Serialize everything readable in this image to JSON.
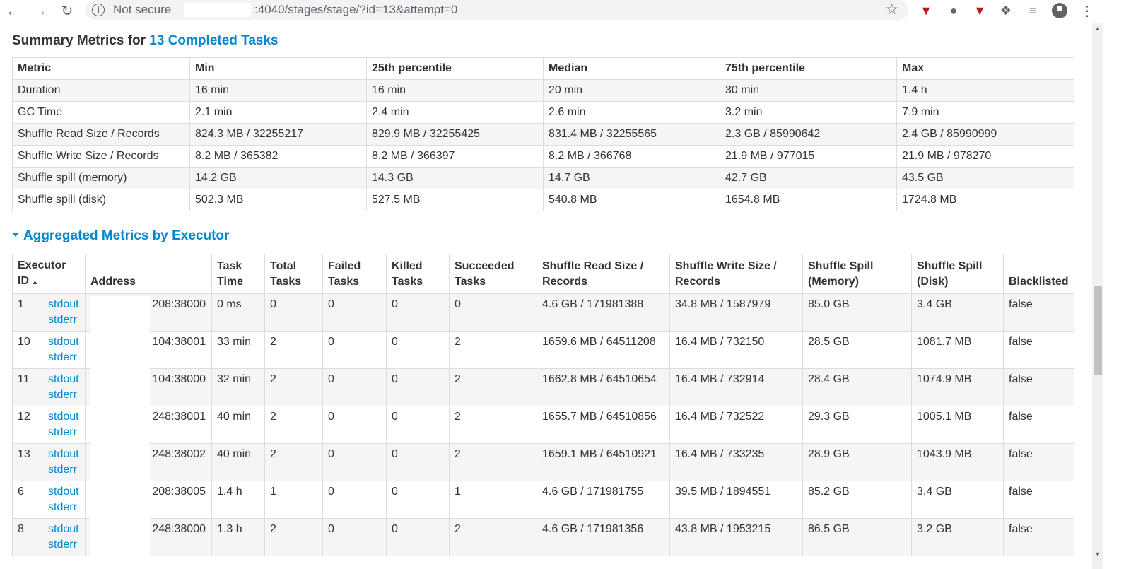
{
  "browser": {
    "secure_label": "Not secure",
    "url": ":4040/stages/stage/?id=13&attempt=0"
  },
  "summary": {
    "title_prefix": "Summary Metrics for ",
    "title_link": "13 Completed Tasks",
    "headers": [
      "Metric",
      "Min",
      "25th percentile",
      "Median",
      "75th percentile",
      "Max"
    ],
    "rows": [
      [
        "Duration",
        "16 min",
        "16 min",
        "20 min",
        "30 min",
        "1.4 h"
      ],
      [
        "GC Time",
        "2.1 min",
        "2.4 min",
        "2.6 min",
        "3.2 min",
        "7.9 min"
      ],
      [
        "Shuffle Read Size / Records",
        "824.3 MB / 32255217",
        "829.9 MB / 32255425",
        "831.4 MB / 32255565",
        "2.3 GB / 85990642",
        "2.4 GB / 85990999"
      ],
      [
        "Shuffle Write Size / Records",
        "8.2 MB / 365382",
        "8.2 MB / 366397",
        "8.2 MB / 366768",
        "21.9 MB / 977015",
        "21.9 MB / 978270"
      ],
      [
        "Shuffle spill (memory)",
        "14.2 GB",
        "14.3 GB",
        "14.7 GB",
        "42.7 GB",
        "43.5 GB"
      ],
      [
        "Shuffle spill (disk)",
        "502.3 MB",
        "527.5 MB",
        "540.8 MB",
        "1654.8 MB",
        "1724.8 MB"
      ]
    ]
  },
  "executors": {
    "title": "Aggregated Metrics by Executor",
    "headers": {
      "executor_id": "Executor ID",
      "address": "Address",
      "task_time": "Task Time",
      "total_tasks": "Total Tasks",
      "failed_tasks": "Failed Tasks",
      "killed_tasks": "Killed Tasks",
      "succeeded_tasks": "Succeeded Tasks",
      "shuffle_read": "Shuffle Read Size / Records",
      "shuffle_write": "Shuffle Write Size / Records",
      "spill_memory": "Shuffle Spill (Memory)",
      "spill_disk": "Shuffle Spill (Disk)",
      "blacklisted": "Blacklisted"
    },
    "sort_indicator": "▲",
    "stdout_label": "stdout",
    "stderr_label": "stderr",
    "rows": [
      {
        "id": "1",
        "address": "208:38000",
        "task_time": "0 ms",
        "total": "0",
        "failed": "0",
        "killed": "0",
        "succeeded": "0",
        "read": "4.6 GB / 171981388",
        "write": "34.8 MB / 1587979",
        "spill_mem": "85.0 GB",
        "spill_disk": "3.4 GB",
        "blacklisted": "false"
      },
      {
        "id": "10",
        "address": "104:38001",
        "task_time": "33 min",
        "total": "2",
        "failed": "0",
        "killed": "0",
        "succeeded": "2",
        "read": "1659.6 MB / 64511208",
        "write": "16.4 MB / 732150",
        "spill_mem": "28.5 GB",
        "spill_disk": "1081.7 MB",
        "blacklisted": "false"
      },
      {
        "id": "11",
        "address": "104:38000",
        "task_time": "32 min",
        "total": "2",
        "failed": "0",
        "killed": "0",
        "succeeded": "2",
        "read": "1662.8 MB / 64510654",
        "write": "16.4 MB / 732914",
        "spill_mem": "28.4 GB",
        "spill_disk": "1074.9 MB",
        "blacklisted": "false"
      },
      {
        "id": "12",
        "address": "248:38001",
        "task_time": "40 min",
        "total": "2",
        "failed": "0",
        "killed": "0",
        "succeeded": "2",
        "read": "1655.7 MB / 64510856",
        "write": "16.4 MB / 732522",
        "spill_mem": "29.3 GB",
        "spill_disk": "1005.1 MB",
        "blacklisted": "false"
      },
      {
        "id": "13",
        "address": "248:38002",
        "task_time": "40 min",
        "total": "2",
        "failed": "0",
        "killed": "0",
        "succeeded": "2",
        "read": "1659.1 MB / 64510921",
        "write": "16.4 MB / 733235",
        "spill_mem": "28.9 GB",
        "spill_disk": "1043.9 MB",
        "blacklisted": "false"
      },
      {
        "id": "6",
        "address": "208:38005",
        "task_time": "1.4 h",
        "total": "1",
        "failed": "0",
        "killed": "0",
        "succeeded": "1",
        "read": "4.6 GB / 171981755",
        "write": "39.5 MB / 1894551",
        "spill_mem": "85.2 GB",
        "spill_disk": "3.4 GB",
        "blacklisted": "false"
      },
      {
        "id": "8",
        "address": "248:38000",
        "task_time": "1.3 h",
        "total": "2",
        "failed": "0",
        "killed": "0",
        "succeeded": "2",
        "read": "4.6 GB / 171981356",
        "write": "43.8 MB / 1953215",
        "spill_mem": "86.5 GB",
        "spill_disk": "3.2 GB",
        "blacklisted": "false"
      }
    ]
  },
  "icons": {
    "back": "arrow-left",
    "forward": "arrow-right",
    "reload": "reload",
    "info": "info",
    "star": "star",
    "extensions": [
      "mcafee-shield",
      "circle",
      "mcafee-shield",
      "puzzle",
      "media-queue"
    ],
    "profile": "avatar",
    "menu": "kebab"
  },
  "colors": {
    "link": "#0088cc",
    "stripe": "#f5f5f5",
    "border": "#dddddd"
  }
}
